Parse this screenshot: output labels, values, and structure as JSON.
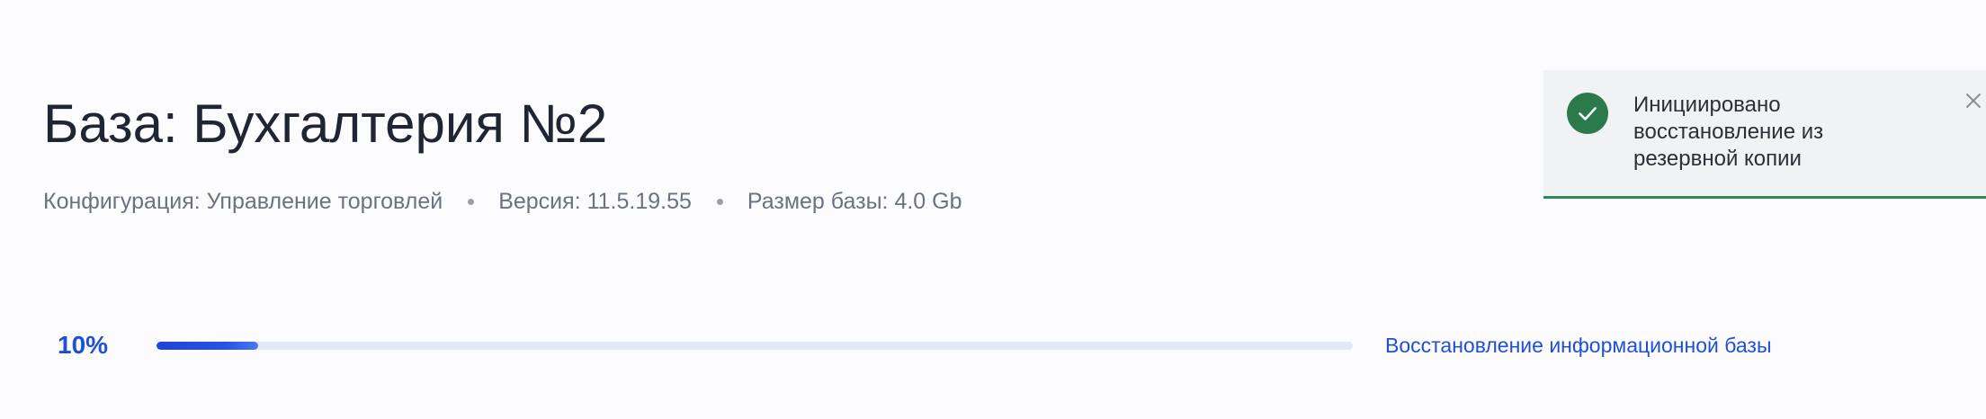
{
  "page": {
    "title": "База: Бухгалтерия №2",
    "meta": {
      "configuration": "Конфигурация: Управление торговлей",
      "version": "Версия: 11.5.19.55",
      "size": "Размер базы: 4.0 Gb"
    }
  },
  "progress": {
    "percent_label": "10%",
    "value": 0.085,
    "label": "Восстановление информационной базы"
  },
  "toast": {
    "icon": "check-circle-icon",
    "message": "Инициировано восстановление из резервной копии",
    "close_icon": "close-icon",
    "colors": {
      "success": "#2b7a4b",
      "background": "#f1f2f4"
    }
  },
  "colors": {
    "accent": "#1e4fd8",
    "text_primary": "#1f2533",
    "text_secondary": "#6b7280"
  }
}
